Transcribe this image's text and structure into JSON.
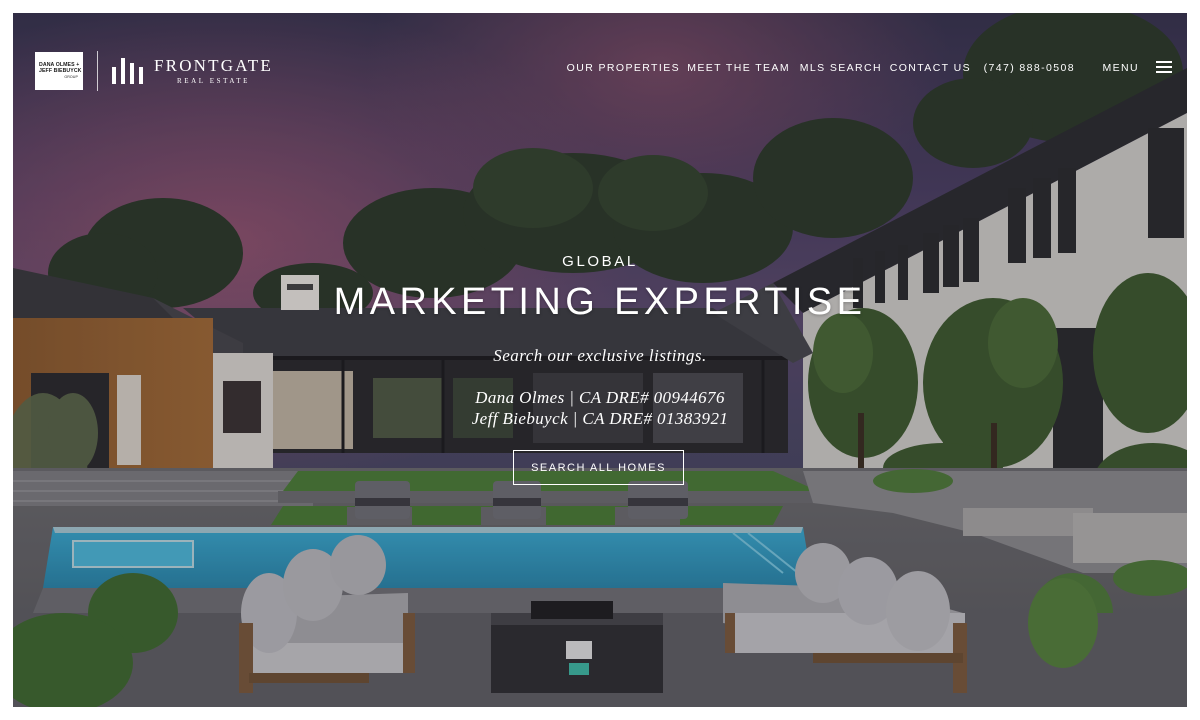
{
  "brand": {
    "badge_line1": "DANA OLMES +",
    "badge_line2": "JEFF BIEBUYCK",
    "badge_line3": "GROUP",
    "name": "FRONTGATE",
    "sub": "REAL ESTATE"
  },
  "nav": {
    "items": [
      "OUR PROPERTIES",
      "MEET THE TEAM",
      "MLS SEARCH",
      "CONTACT US",
      "(747) 888-0508",
      "MENU"
    ],
    "menu_icon": "hamburger-icon"
  },
  "hero": {
    "kicker": "GLOBAL",
    "title": "MARKETING EXPERTISE",
    "tagline": "Search our exclusive listings.",
    "agent1": "Dana Olmes | CA DRE# 00944676",
    "agent2": "Jeff Biebuyck | CA DRE# 01383921",
    "cta": "SEARCH ALL HOMES"
  },
  "colors": {
    "text": "#ffffff",
    "pool": "#2f9fc6",
    "lawn": "#3f7a34",
    "sky_top": "#3b3656",
    "sky_glow": "#8a4e6a"
  }
}
